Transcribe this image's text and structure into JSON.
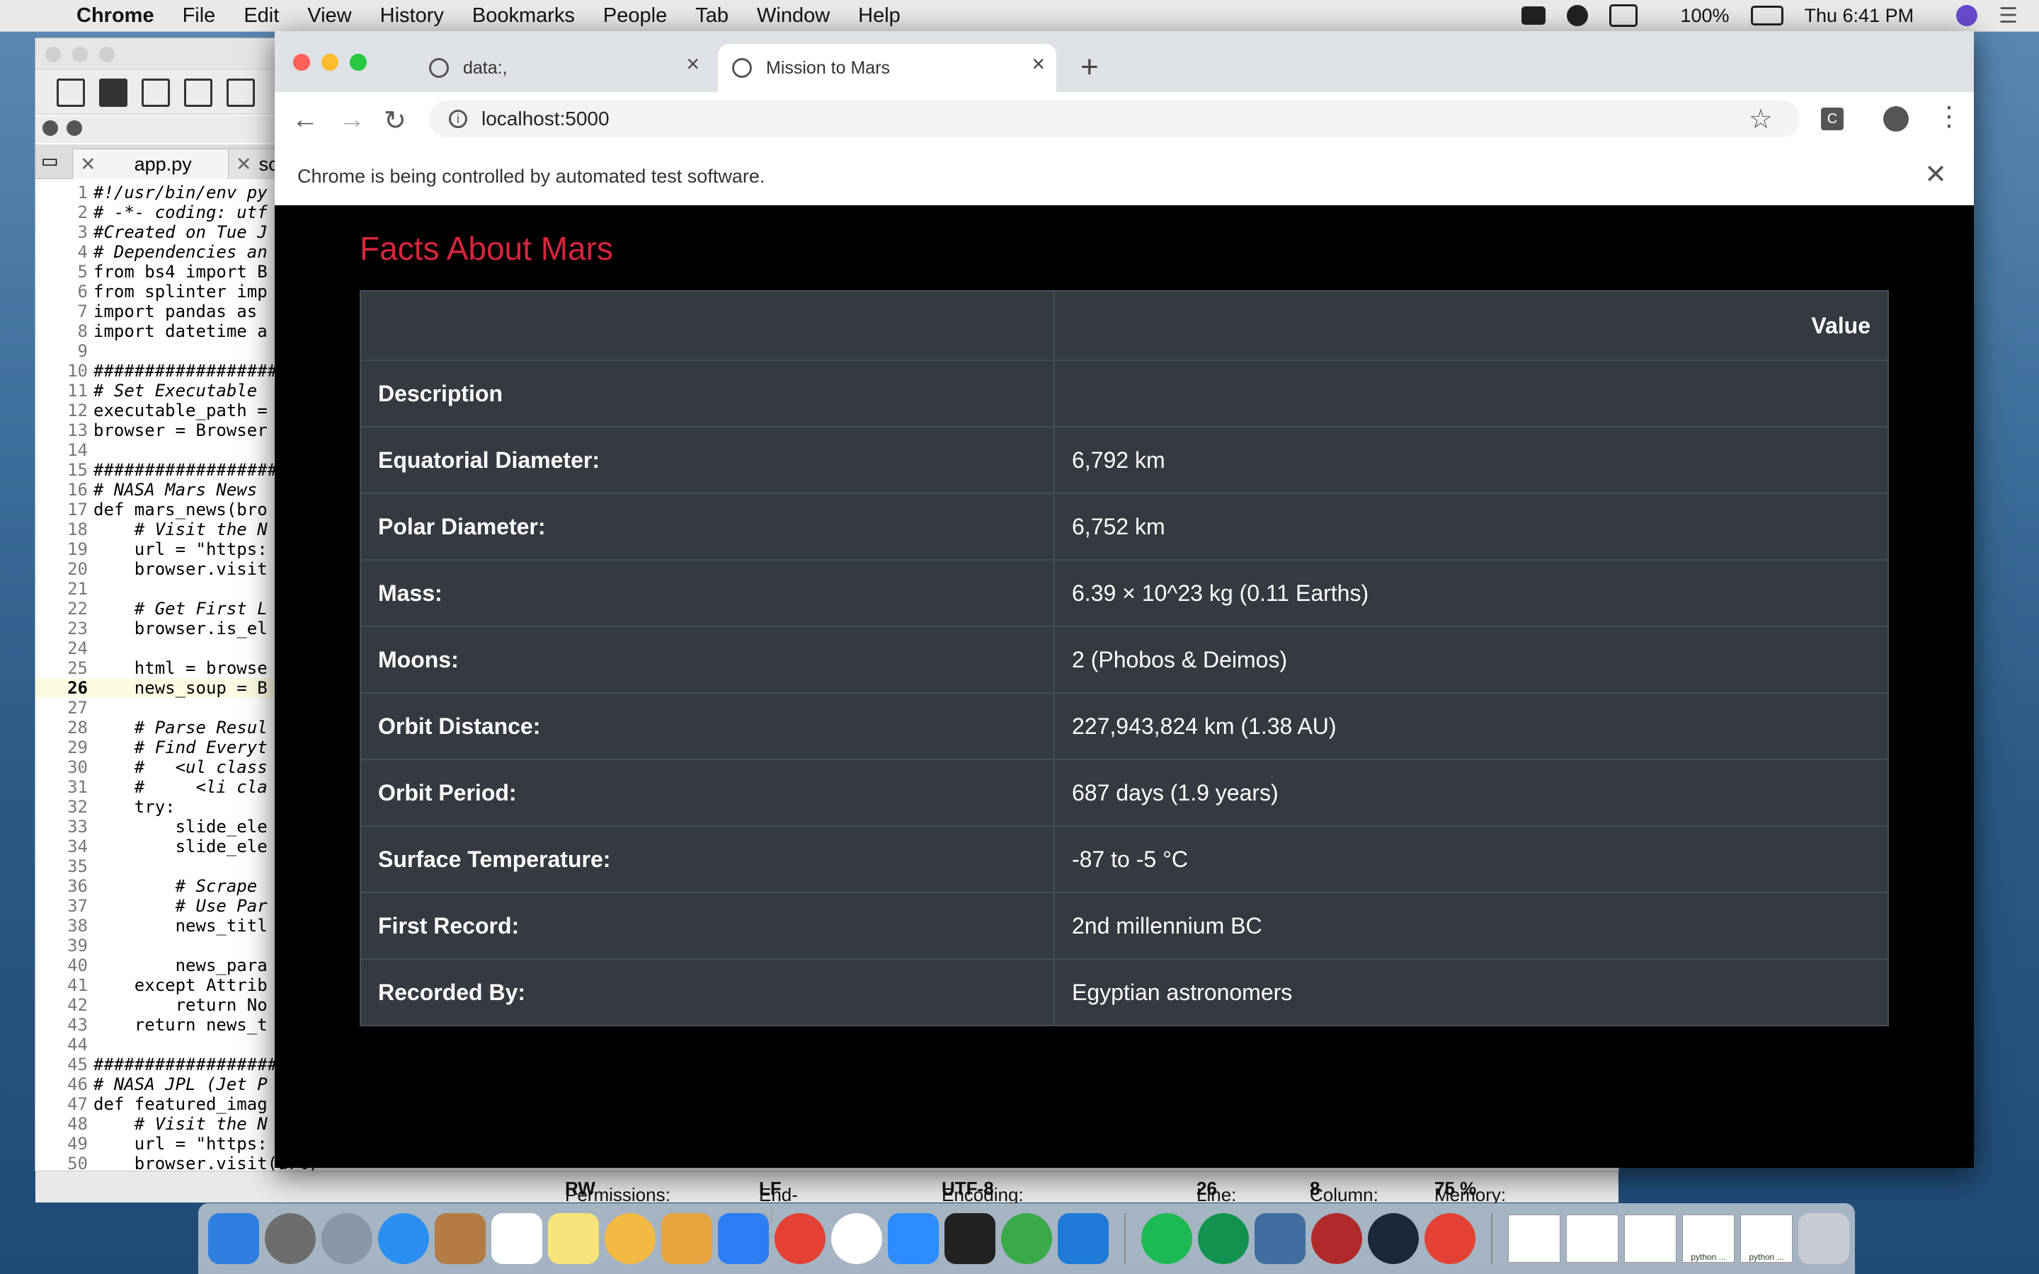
{
  "menubar": {
    "app": "Chrome",
    "items": [
      "File",
      "Edit",
      "View",
      "History",
      "Bookmarks",
      "People",
      "Tab",
      "Window",
      "Help"
    ],
    "battery": "100%",
    "clock": "Thu 6:41 PM"
  },
  "editor": {
    "tabs": [
      "app.py",
      "sc"
    ],
    "code_lines": [
      "#!/usr/bin/env py",
      "# -*- coding: utf",
      "#Created on Tue J",
      "# Dependencies an",
      "from bs4 import B",
      "from splinter imp",
      "import pandas as ",
      "import datetime a",
      "",
      "##################",
      "# Set Executable ",
      "executable_path =",
      "browser = Browser",
      "",
      "##################",
      "# NASA Mars News ",
      "def mars_news(bro",
      "    # Visit the N",
      "    url = \"https:",
      "    browser.visit",
      "",
      "    # Get First L",
      "    browser.is_el",
      "",
      "    html = browse",
      "    news_soup = B",
      "",
      "    # Parse Resul",
      "    # Find Everyt",
      "    #   <ul class",
      "    #     <li cla",
      "    try:",
      "        slide_ele",
      "        slide_ele",
      "",
      "        # Scrape ",
      "        # Use Par",
      "        news_titl",
      "",
      "        news_para",
      "    except Attrib",
      "        return No",
      "    return news_t",
      "",
      "##################",
      "# NASA JPL (Jet P",
      "def featured_imag",
      "    # Visit the N",
      "    url = \"https:",
      "    browser.visit(url)"
    ],
    "status": {
      "permissions_label": "Permissions:",
      "permissions": "RW",
      "eol_label": "End-of-lines:",
      "eol": "LF",
      "encoding_label": "Encoding:",
      "encoding": "UTF-8",
      "line_label": "Line:",
      "line": "26",
      "column_label": "Column:",
      "column": "8",
      "memory_label": "Memory:",
      "memory": "75 %"
    }
  },
  "chrome": {
    "tabs": [
      {
        "title": "data:,",
        "active": false
      },
      {
        "title": "Mission to Mars",
        "active": true
      }
    ],
    "url": "localhost:5000",
    "extension_label": "C",
    "automation_notice": "Chrome is being controlled by automated test software."
  },
  "page": {
    "heading": "Facts About Mars",
    "table_header": [
      "",
      "Value"
    ],
    "rows": [
      {
        "label": "Description",
        "value": ""
      },
      {
        "label": "Equatorial Diameter:",
        "value": "6,792 km"
      },
      {
        "label": "Polar Diameter:",
        "value": "6,752 km"
      },
      {
        "label": "Mass:",
        "value": "6.39 × 10^23 kg (0.11 Earths)"
      },
      {
        "label": "Moons:",
        "value": "2 (Phobos & Deimos)"
      },
      {
        "label": "Orbit Distance:",
        "value": "227,943,824 km (1.38 AU)"
      },
      {
        "label": "Orbit Period:",
        "value": "687 days (1.9 years)"
      },
      {
        "label": "Surface Temperature:",
        "value": "-87 to -5 °C"
      },
      {
        "label": "First Record:",
        "value": "2nd millennium BC"
      },
      {
        "label": "Recorded By:",
        "value": "Egyptian astronomers"
      }
    ]
  },
  "dock": {
    "thumb_labels": [
      "python ...",
      "python ..."
    ]
  },
  "colors": {
    "heading_red": "#d7263d",
    "table_bg": "#343a40",
    "table_border": "#454d55"
  }
}
